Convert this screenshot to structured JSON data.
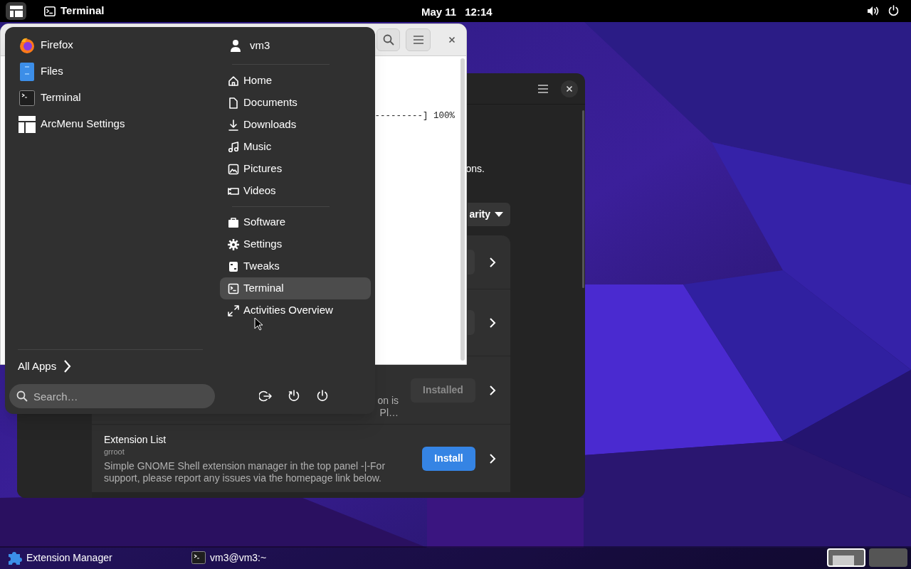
{
  "top_bar": {
    "menu_button": {
      "selected": true
    },
    "active_app": "Terminal",
    "date": "May 11",
    "time": "12:14"
  },
  "terminal_window": {
    "lines": [
      "---------] 100%"
    ]
  },
  "extension_manager": {
    "intro_fragment": "ons.",
    "sort_label": "arity",
    "rows": [
      {
        "kind": "covered"
      },
      {
        "kind": "covered"
      },
      {
        "kind": "installed",
        "description_fragments": [
          "on is",
          "Pl…"
        ],
        "button": "Installed"
      },
      {
        "kind": "install",
        "name": "Extension List",
        "author": "grroot",
        "description": "Simple GNOME Shell extension manager in the top panel -|-For support, please report any issues via the homepage link below.",
        "button": "Install"
      }
    ]
  },
  "arc_menu": {
    "apps": [
      {
        "label": "Firefox"
      },
      {
        "label": "Files"
      },
      {
        "label": "Terminal"
      },
      {
        "label": "ArcMenu Settings"
      }
    ],
    "user": "vm3",
    "groups": [
      [
        {
          "label": "Home",
          "selected": false
        },
        {
          "label": "Documents",
          "selected": false
        },
        {
          "label": "Downloads",
          "selected": false
        },
        {
          "label": "Music",
          "selected": false
        },
        {
          "label": "Pictures",
          "selected": false
        },
        {
          "label": "Videos",
          "selected": false
        }
      ],
      [
        {
          "label": "Software",
          "selected": false
        },
        {
          "label": "Settings",
          "selected": false
        },
        {
          "label": "Tweaks",
          "selected": false
        },
        {
          "label": "Terminal",
          "selected": true
        },
        {
          "label": "Activities Overview",
          "selected": false
        }
      ]
    ],
    "all_apps": "All Apps",
    "search": {
      "placeholder": "Search…"
    }
  },
  "taskbar": {
    "items": [
      {
        "label": "Extension Manager"
      },
      {
        "label": "vm3@vm3:~"
      }
    ],
    "workspaces": [
      {
        "selected": true
      },
      {
        "selected": false
      }
    ]
  }
}
